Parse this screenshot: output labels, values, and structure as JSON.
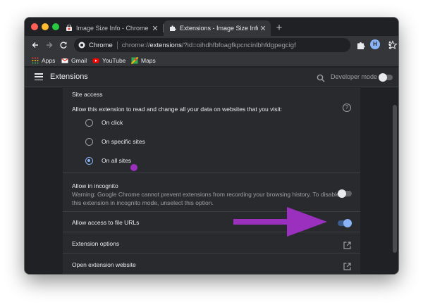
{
  "tabs": [
    {
      "title": "Image Size Info - Chrome Web...",
      "icon": "chrome-web-store-icon"
    },
    {
      "title": "Extensions - Image Size Info",
      "icon": "puzzle-icon"
    }
  ],
  "omnibox": {
    "chip": "Chrome",
    "scheme": "chrome://",
    "host": "extensions",
    "path": "/?id=oihdhfbfoagfkpcncinlbhfdgpegcigf"
  },
  "avatar_letter": "H",
  "bookmarks": [
    {
      "label": "Apps",
      "icon": "apps-grid-icon"
    },
    {
      "label": "Gmail",
      "icon": "gmail-icon"
    },
    {
      "label": "YouTube",
      "icon": "youtube-icon"
    },
    {
      "label": "Maps",
      "icon": "maps-icon"
    }
  ],
  "header": {
    "title": "Extensions",
    "developer_mode_label": "Developer mode",
    "developer_mode_on": false
  },
  "site_access": {
    "label": "Site access",
    "description": "Allow this extension to read and change all your data on websites that you visit:",
    "options": [
      {
        "label": "On click",
        "checked": false
      },
      {
        "label": "On specific sites",
        "checked": false
      },
      {
        "label": "On all sites",
        "checked": true
      }
    ]
  },
  "incognito": {
    "title": "Allow in incognito",
    "warning": "Warning: Google Chrome cannot prevent extensions from recording your browsing history. To disable this extension in incognito mode, unselect this option.",
    "enabled": false
  },
  "file_urls": {
    "title": "Allow access to file URLs",
    "enabled": true
  },
  "extension_options": {
    "title": "Extension options"
  },
  "open_website": {
    "title": "Open extension website"
  },
  "colors": {
    "background": "#202124",
    "card": "#292a2d",
    "accent_blue": "#8ab4f8",
    "annotation_purple": "#9b2fbe"
  }
}
